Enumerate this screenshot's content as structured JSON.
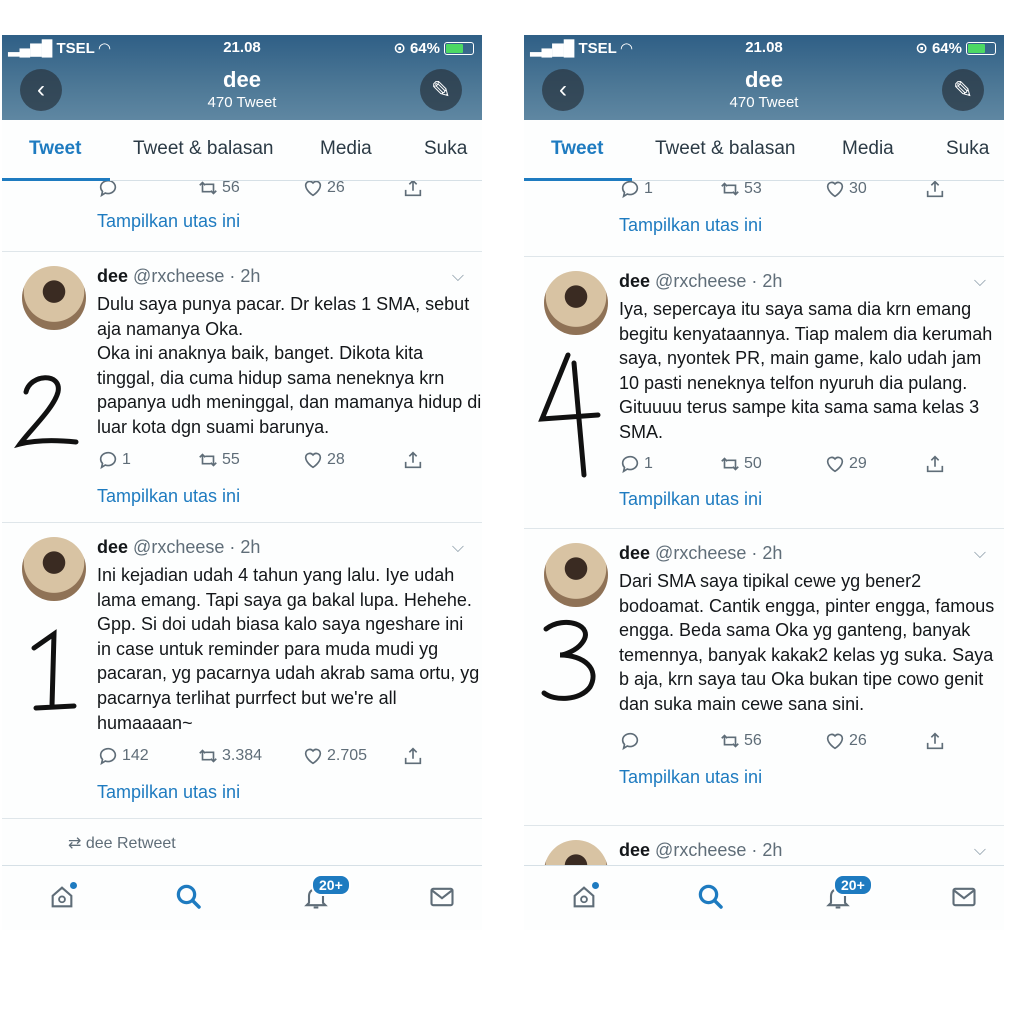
{
  "phones": [
    {
      "status": {
        "carrier": "TSEL",
        "time": "21.08",
        "battery": "64%"
      },
      "profile": {
        "name": "dee",
        "tweet_count": "470 Tweet"
      },
      "tabs": [
        "Tweet",
        "Tweet & balasan",
        "Media",
        "Suka"
      ],
      "top_actions": {
        "reply": "",
        "retweet": "56",
        "like": "26"
      },
      "thread_label": "Tampilkan utas ini",
      "tweets": [
        {
          "name": "dee",
          "handle": "@rxcheese · 2h",
          "hand_number": "2",
          "text": "Dulu saya punya pacar. Dr kelas 1 SMA, sebut aja namanya Oka.\nOka ini anaknya baik, banget. Dikota kita tinggal, dia cuma hidup sama neneknya krn papanya udh meninggal, dan mamanya hidup di luar kota dgn suami barunya.",
          "reply": "1",
          "retweet": "55",
          "like": "28"
        },
        {
          "name": "dee",
          "handle": "@rxcheese · 2h",
          "hand_number": "1",
          "text": "Ini kejadian udah 4 tahun yang lalu. Iye udah lama emang. Tapi saya ga bakal lupa. Hehehe. Gpp. Si doi udah biasa kalo saya ngeshare ini in case untuk reminder para muda mudi yg pacaran, yg pacarnya udah akrab sama ortu, yg pacarnya terlihat purrfect but we're all humaaaan~",
          "reply": "142",
          "retweet": "3.384",
          "like": "2.705"
        }
      ],
      "retweet_note": "dee Retweet",
      "nav": {
        "badge": "20+"
      }
    },
    {
      "status": {
        "carrier": "TSEL",
        "time": "21.08",
        "battery": "64%"
      },
      "profile": {
        "name": "dee",
        "tweet_count": "470 Tweet"
      },
      "tabs": [
        "Tweet",
        "Tweet & balasan",
        "Media",
        "Suka"
      ],
      "top_actions": {
        "reply": "1",
        "retweet": "53",
        "like": "30"
      },
      "thread_label": "Tampilkan utas ini",
      "tweets": [
        {
          "name": "dee",
          "handle": "@rxcheese · 2h",
          "hand_number": "4",
          "text": "Iya, sepercaya itu saya sama dia krn emang begitu kenyataannya. Tiap malem dia kerumah saya, nyontek PR, main game, kalo udah jam 10 pasti neneknya telfon nyuruh dia pulang. Gituuuu terus sampe kita sama sama kelas 3 SMA.",
          "reply": "1",
          "retweet": "50",
          "like": "29"
        },
        {
          "name": "dee",
          "handle": "@rxcheese · 2h",
          "hand_number": "3",
          "text": "Dari SMA saya tipikal cewe yg bener2 bodoamat. Cantik engga, pinter engga, famous engga. Beda sama Oka yg ganteng, banyak temennya, banyak kakak2 kelas yg suka. Saya b aja, krn saya tau Oka bukan tipe cowo genit dan suka main cewe sana sini.",
          "reply": "",
          "retweet": "56",
          "like": "26"
        }
      ],
      "partial_tweet": {
        "name": "dee",
        "handle": "@rxcheese · 2h"
      },
      "nav": {
        "badge": "20+"
      }
    }
  ]
}
